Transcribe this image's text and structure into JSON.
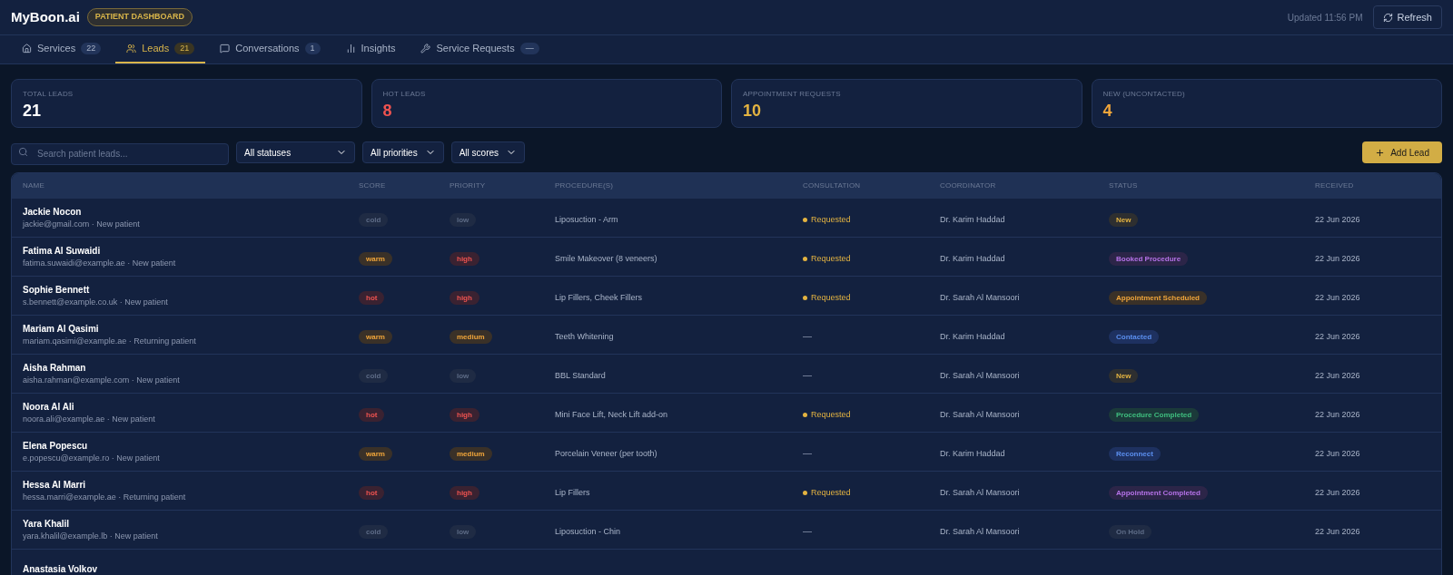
{
  "header": {
    "brand": "MyBoon.ai",
    "badge": "PATIENT DASHBOARD",
    "updated": "Updated 11:56 PM",
    "refresh": "Refresh"
  },
  "tabs": [
    {
      "kind": "services",
      "label": "Services",
      "count": "22",
      "selected": false
    },
    {
      "kind": "leads",
      "label": "Leads",
      "count": "21",
      "selected": true
    },
    {
      "kind": "conversations",
      "label": "Conversations",
      "count": "1",
      "selected": false
    },
    {
      "kind": "insights",
      "label": "Insights",
      "selected": false
    },
    {
      "kind": "requests",
      "label": "Service Requests",
      "count": "—",
      "selected": false
    }
  ],
  "stats": [
    {
      "label": "TOTAL LEADS",
      "value": "21",
      "color": "#ffffff"
    },
    {
      "label": "HOT LEADS",
      "value": "8",
      "color": "#ef5350"
    },
    {
      "label": "APPOINTMENT REQUESTS",
      "value": "10",
      "color": "#e3b341"
    },
    {
      "label": "NEW (UNCONTACTED)",
      "value": "4",
      "color": "#f0a53a"
    }
  ],
  "filters": {
    "search_placeholder": "Search patient leads...",
    "dropdowns": [
      "All statuses",
      "All priorities",
      "All scores"
    ],
    "add_button": "Add Lead"
  },
  "table": {
    "columns": [
      "NAME",
      "SCORE",
      "PRIORITY",
      "PROCEDURE(S)",
      "CONSULTATION",
      "COORDINATOR",
      "STATUS",
      "RECEIVED"
    ],
    "rows": [
      {
        "name": "Jackie Nocon",
        "sub": "jackie@gmail.com · New patient",
        "score": "cold",
        "priority": "low",
        "procedure": "Liposuction - Arm",
        "consultation": {
          "kind": "requested",
          "text": "Requested"
        },
        "coordinator": "Dr. Karim Haddad",
        "status": {
          "kind": "new",
          "text": "New"
        },
        "received": "22 Jun 2026"
      },
      {
        "name": "Fatima Al Suwaidi",
        "sub": "fatima.suwaidi@example.ae · New patient",
        "score": "warm",
        "priority": "high",
        "procedure": "Smile Makeover (8 veneers)",
        "consultation": {
          "kind": "requested",
          "text": "Requested"
        },
        "coordinator": "Dr. Karim Haddad",
        "status": {
          "kind": "booked",
          "text": "Booked Procedure"
        },
        "received": "22 Jun 2026"
      },
      {
        "name": "Sophie Bennett",
        "sub": "s.bennett@example.co.uk · New patient",
        "score": "hot",
        "priority": "high",
        "procedure": "Lip Fillers, Cheek Fillers",
        "consultation": {
          "kind": "requested",
          "text": "Requested"
        },
        "coordinator": "Dr. Sarah Al Mansoori",
        "status": {
          "kind": "scheduled",
          "text": "Appointment Scheduled"
        },
        "received": "22 Jun 2026"
      },
      {
        "name": "Mariam Al Qasimi",
        "sub": "mariam.qasimi@example.ae · Returning patient",
        "score": "warm",
        "priority": "medium",
        "procedure": "Teeth Whitening",
        "consultation": {
          "kind": "none",
          "text": "—"
        },
        "coordinator": "Dr. Karim Haddad",
        "status": {
          "kind": "contacted",
          "text": "Contacted"
        },
        "received": "22 Jun 2026"
      },
      {
        "name": "Aisha Rahman",
        "sub": "aisha.rahman@example.com · New patient",
        "score": "cold",
        "priority": "low",
        "procedure": "BBL Standard",
        "consultation": {
          "kind": "none",
          "text": "—"
        },
        "coordinator": "Dr. Sarah Al Mansoori",
        "status": {
          "kind": "new",
          "text": "New"
        },
        "received": "22 Jun 2026"
      },
      {
        "name": "Noora Al Ali",
        "sub": "noora.ali@example.ae · New patient",
        "score": "hot",
        "priority": "high",
        "procedure": "Mini Face Lift, Neck Lift add-on",
        "consultation": {
          "kind": "requested",
          "text": "Requested"
        },
        "coordinator": "Dr. Sarah Al Mansoori",
        "status": {
          "kind": "completed",
          "text": "Procedure Completed"
        },
        "received": "22 Jun 2026"
      },
      {
        "name": "Elena Popescu",
        "sub": "e.popescu@example.ro · New patient",
        "score": "warm",
        "priority": "medium",
        "procedure": "Porcelain Veneer (per tooth)",
        "consultation": {
          "kind": "none",
          "text": "—"
        },
        "coordinator": "Dr. Karim Haddad",
        "status": {
          "kind": "contacted",
          "text": "Reconnect"
        },
        "received": "22 Jun 2026"
      },
      {
        "name": "Hessa Al Marri",
        "sub": "hessa.marri@example.ae · Returning patient",
        "score": "hot",
        "priority": "high",
        "procedure": "Lip Fillers",
        "consultation": {
          "kind": "requested",
          "text": "Requested"
        },
        "coordinator": "Dr. Sarah Al Mansoori",
        "status": {
          "kind": "booked",
          "text": "Appointment Completed"
        },
        "received": "22 Jun 2026"
      },
      {
        "name": "Yara Khalil",
        "sub": "yara.khalil@example.lb · New patient",
        "score": "cold",
        "priority": "low",
        "procedure": "Liposuction - Chin",
        "consultation": {
          "kind": "none",
          "text": "—"
        },
        "coordinator": "Dr. Sarah Al Mansoori",
        "status": {
          "kind": "hold",
          "text": "On Hold"
        },
        "received": "22 Jun 2026"
      },
      {
        "name": "Anastasia Volkov"
      }
    ]
  }
}
